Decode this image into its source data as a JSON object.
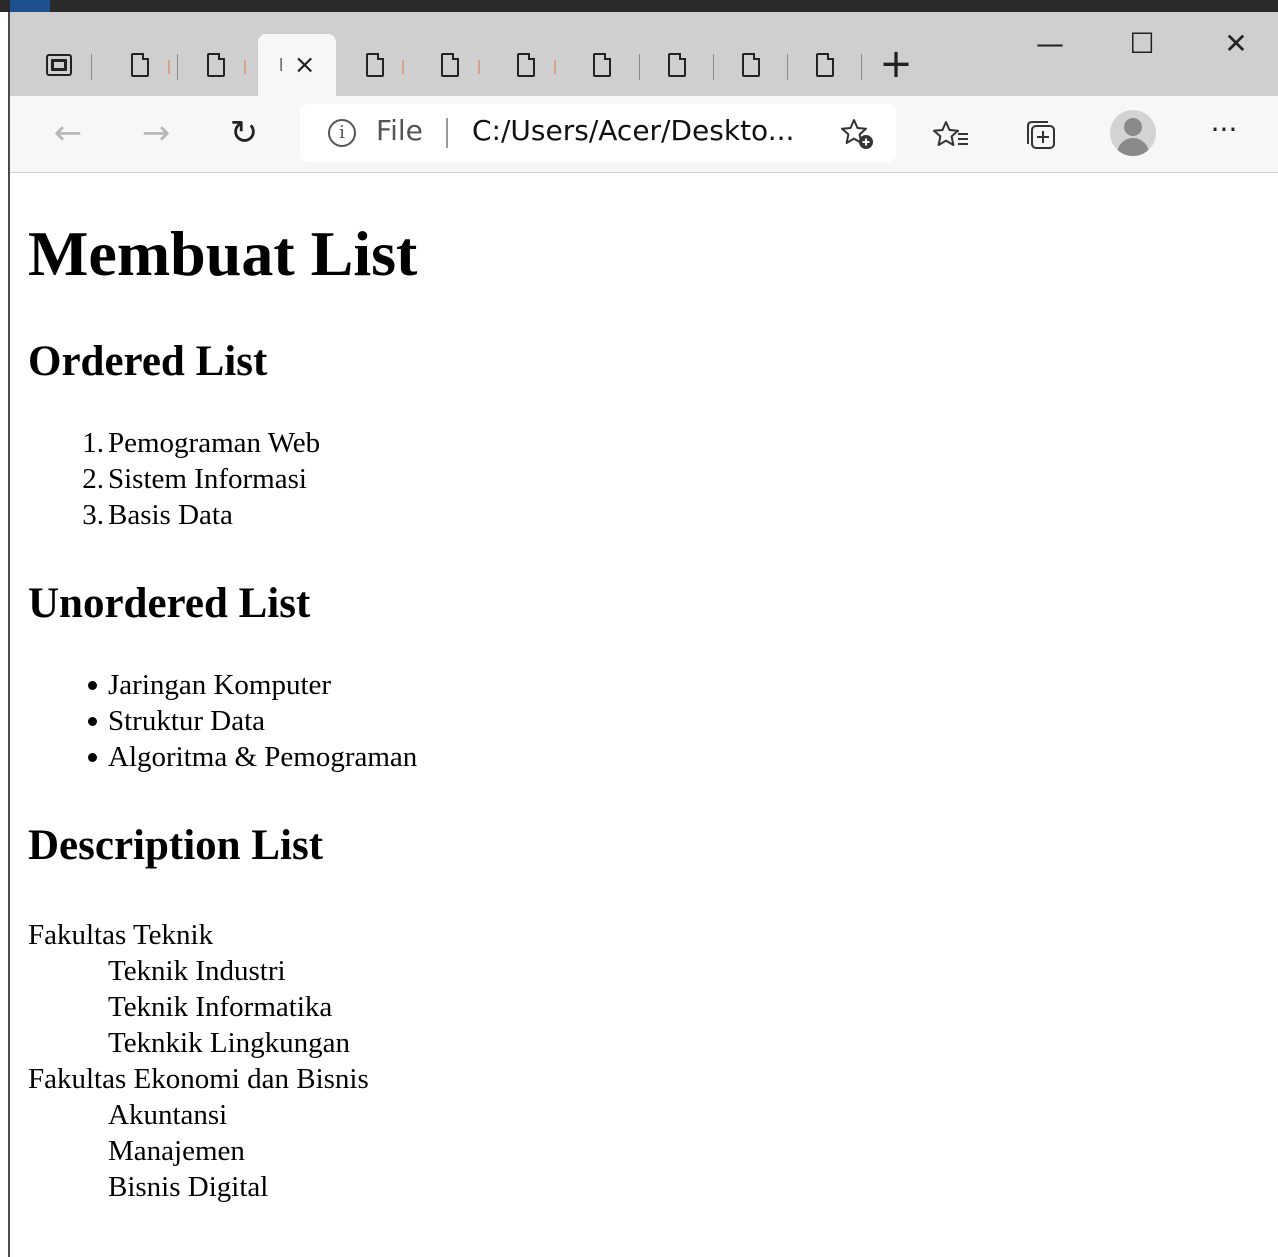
{
  "browser": {
    "address": {
      "info_symbol": "i",
      "scheme_label": "File",
      "url": "C:/Users/Acer/Deskto..."
    },
    "controls": {
      "new_tab": "+",
      "minimize": "—",
      "maximize": "☐",
      "close": "✕",
      "more": "···",
      "back": "←",
      "forward": "→",
      "refresh": "↻"
    },
    "active_tab": {
      "label_char": "I",
      "close": "×"
    }
  },
  "page": {
    "title": "Membuat List",
    "ordered": {
      "heading": "Ordered List",
      "items": [
        {
          "num": "1.",
          "text": "Pemograman Web"
        },
        {
          "num": "2.",
          "text": "Sistem Informasi"
        },
        {
          "num": "3.",
          "text": "Basis Data"
        }
      ]
    },
    "unordered": {
      "heading": "Unordered List",
      "items": [
        "Jaringan Komputer",
        "Struktur Data",
        "Algoritma & Pemograman"
      ]
    },
    "description": {
      "heading": "Description List",
      "groups": [
        {
          "term": "Fakultas Teknik",
          "defs": [
            "Teknik Industri",
            "Teknik Informatika",
            "Teknkik Lingkungan"
          ]
        },
        {
          "term": "Fakultas Ekonomi dan Bisnis",
          "defs": [
            "Akuntansi",
            "Manajemen",
            "Bisnis Digital"
          ]
        }
      ]
    }
  }
}
